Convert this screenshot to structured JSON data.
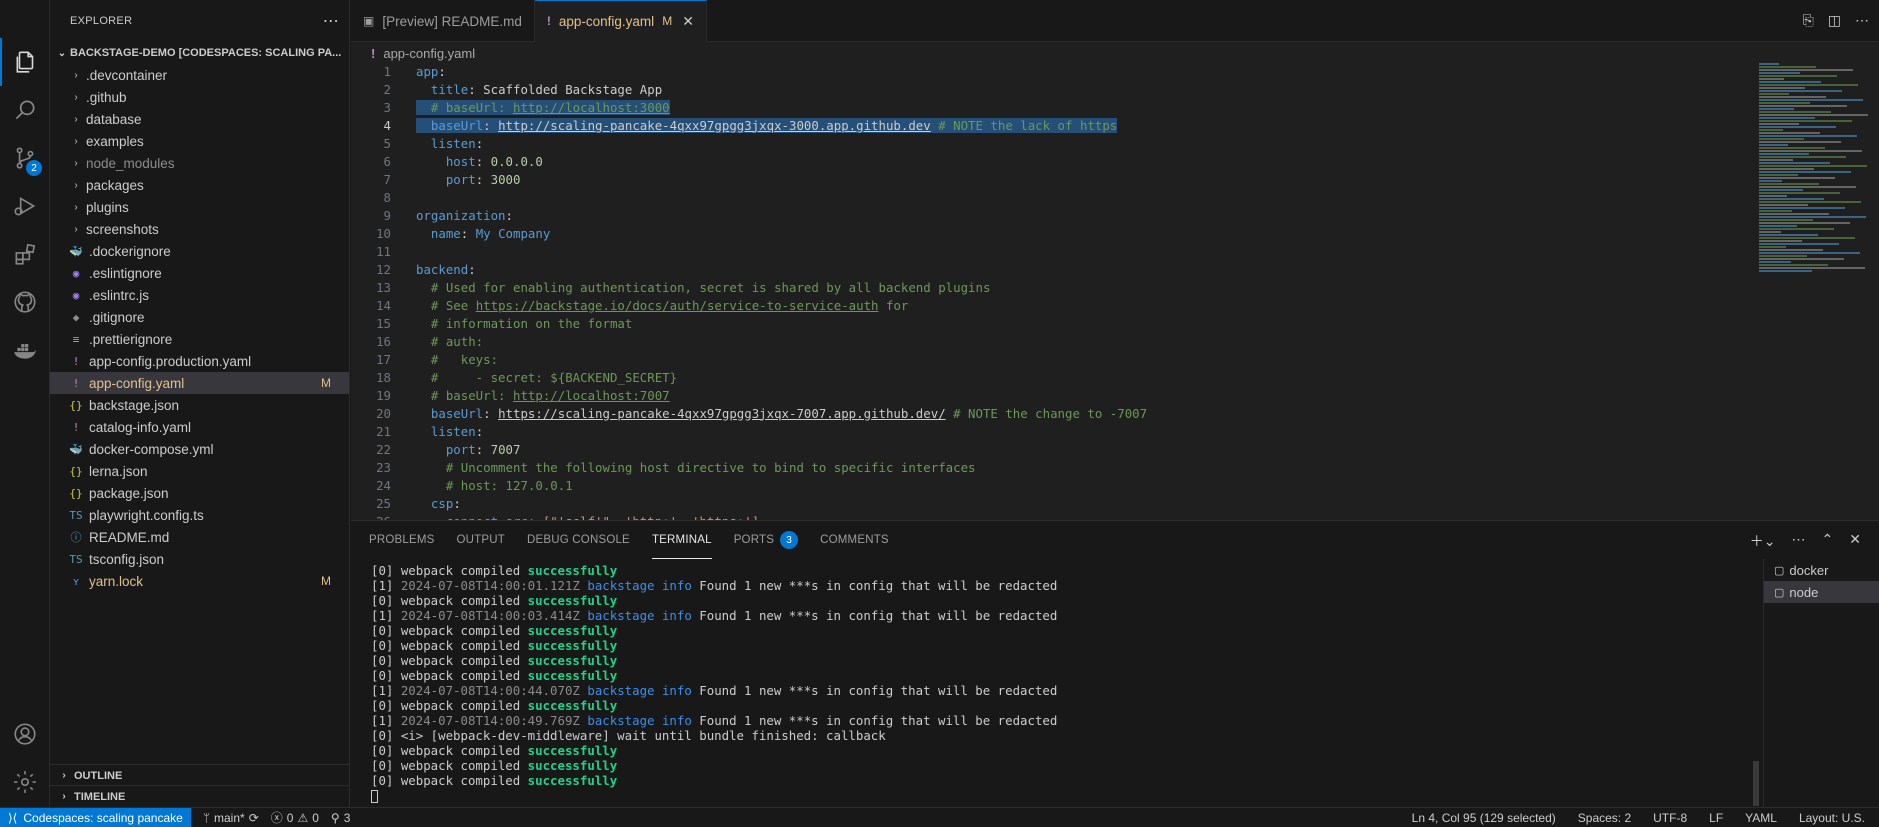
{
  "explorer": {
    "title": "EXPLORER",
    "project": "BACKSTAGE-DEMO [CODESPACES: SCALING PA...",
    "items": [
      {
        "name": ".devcontainer",
        "type": "folder"
      },
      {
        "name": ".github",
        "type": "folder"
      },
      {
        "name": "database",
        "type": "folder"
      },
      {
        "name": "examples",
        "type": "folder"
      },
      {
        "name": "node_modules",
        "type": "folder",
        "dim": true
      },
      {
        "name": "packages",
        "type": "folder"
      },
      {
        "name": "plugins",
        "type": "folder"
      },
      {
        "name": "screenshots",
        "type": "folder"
      },
      {
        "name": ".dockerignore",
        "icon": "docker-icon"
      },
      {
        "name": ".eslintignore",
        "icon": "eslint-icon"
      },
      {
        "name": ".eslintrc.js",
        "icon": "eslint-icon"
      },
      {
        "name": ".gitignore",
        "icon": "git-icon"
      },
      {
        "name": ".prettierignore",
        "icon": "lines-icon"
      },
      {
        "name": "app-config.production.yaml",
        "icon": "yaml-icon"
      },
      {
        "name": "app-config.yaml",
        "icon": "yaml-icon",
        "selected": true,
        "modified": "M"
      },
      {
        "name": "backstage.json",
        "icon": "json-icon"
      },
      {
        "name": "catalog-info.yaml",
        "icon": "yaml-icon"
      },
      {
        "name": "docker-compose.yml",
        "icon": "docker-icon"
      },
      {
        "name": "lerna.json",
        "icon": "json-icon"
      },
      {
        "name": "package.json",
        "icon": "json-icon"
      },
      {
        "name": "playwright.config.ts",
        "icon": "ts-icon"
      },
      {
        "name": "README.md",
        "icon": "info-icon"
      },
      {
        "name": "tsconfig.json",
        "icon": "ts-icon"
      },
      {
        "name": "yarn.lock",
        "icon": "yarn-icon",
        "modified": "M"
      }
    ],
    "outline": "OUTLINE",
    "timeline": "TIMELINE"
  },
  "activity": {
    "scm_badge": "2"
  },
  "tabs": [
    {
      "label": "[Preview] README.md"
    },
    {
      "label": "app-config.yaml",
      "modified": "M",
      "active": true
    }
  ],
  "breadcrumb": "app-config.yaml",
  "code_lines": [
    [
      {
        "t": "app",
        "c": "k"
      },
      {
        "t": ":"
      }
    ],
    [
      {
        "t": "  "
      },
      {
        "t": "title",
        "c": "k"
      },
      {
        "t": ": Scaffolded Backstage App"
      }
    ],
    [
      {
        "t": "  "
      },
      {
        "t": "# baseUrl: ",
        "c": "c"
      },
      {
        "t": "http://localhost:3000",
        "c": "cu"
      }
    ],
    [
      {
        "t": "  "
      },
      {
        "t": "baseUrl",
        "c": "k"
      },
      {
        "t": ": "
      },
      {
        "t": "http://scaling-pancake-4qxx97gpgg3jxqx-3000.app.github.dev",
        "c": "u"
      },
      {
        "t": " "
      },
      {
        "t": "# NOTE the lack of https",
        "c": "c"
      }
    ],
    [
      {
        "t": "  "
      },
      {
        "t": "listen",
        "c": "k"
      },
      {
        "t": ":"
      }
    ],
    [
      {
        "t": "    "
      },
      {
        "t": "host",
        "c": "k"
      },
      {
        "t": ": "
      },
      {
        "t": "0.0.0.0",
        "c": "n"
      }
    ],
    [
      {
        "t": "    "
      },
      {
        "t": "port",
        "c": "k"
      },
      {
        "t": ": "
      },
      {
        "t": "3000",
        "c": "n"
      }
    ],
    [],
    [
      {
        "t": "organization",
        "c": "k"
      },
      {
        "t": ":"
      }
    ],
    [
      {
        "t": "  "
      },
      {
        "t": "name",
        "c": "k"
      },
      {
        "t": ": "
      },
      {
        "t": "My Company",
        "c": "k"
      }
    ],
    [],
    [
      {
        "t": "backend",
        "c": "k"
      },
      {
        "t": ":"
      }
    ],
    [
      {
        "t": "  "
      },
      {
        "t": "# Used for enabling authentication, secret is shared by all backend plugins",
        "c": "c"
      }
    ],
    [
      {
        "t": "  "
      },
      {
        "t": "# See ",
        "c": "c"
      },
      {
        "t": "https://backstage.io/docs/auth/service-to-service-auth",
        "c": "cu"
      },
      {
        "t": " for",
        "c": "c"
      }
    ],
    [
      {
        "t": "  "
      },
      {
        "t": "# information on the format",
        "c": "c"
      }
    ],
    [
      {
        "t": "  "
      },
      {
        "t": "# auth:",
        "c": "c"
      }
    ],
    [
      {
        "t": "  "
      },
      {
        "t": "#   keys:",
        "c": "c"
      }
    ],
    [
      {
        "t": "  "
      },
      {
        "t": "#     - secret: ${BACKEND_SECRET}",
        "c": "c"
      }
    ],
    [
      {
        "t": "  "
      },
      {
        "t": "# baseUrl: ",
        "c": "c"
      },
      {
        "t": "http://localhost:7007",
        "c": "cu"
      }
    ],
    [
      {
        "t": "  "
      },
      {
        "t": "baseUrl",
        "c": "k"
      },
      {
        "t": ": "
      },
      {
        "t": "https://scaling-pancake-4qxx97gpgg3jxqx-7007.app.github.dev/",
        "c": "u"
      },
      {
        "t": " "
      },
      {
        "t": "# NOTE the change to -7007",
        "c": "c"
      }
    ],
    [
      {
        "t": "  "
      },
      {
        "t": "listen",
        "c": "k"
      },
      {
        "t": ":"
      }
    ],
    [
      {
        "t": "    "
      },
      {
        "t": "port",
        "c": "k"
      },
      {
        "t": ": "
      },
      {
        "t": "7007",
        "c": "n"
      }
    ],
    [
      {
        "t": "    "
      },
      {
        "t": "# Uncomment the following host directive to bind to specific interfaces",
        "c": "c"
      }
    ],
    [
      {
        "t": "    "
      },
      {
        "t": "# host: 127.0.0.1",
        "c": "c"
      }
    ],
    [
      {
        "t": "  "
      },
      {
        "t": "csp",
        "c": "k"
      },
      {
        "t": ":"
      }
    ],
    [
      {
        "t": "    "
      },
      {
        "t": "connect-src",
        "c": "k"
      },
      {
        "t": ": "
      },
      {
        "t": "[\"'self'\", 'http:', 'https:']",
        "c": "s"
      }
    ]
  ],
  "panel": {
    "tabs": [
      "PROBLEMS",
      "OUTPUT",
      "DEBUG CONSOLE",
      "TERMINAL",
      "PORTS",
      "COMMENTS"
    ],
    "active_tab": "TERMINAL",
    "ports_badge": "3",
    "terminal_lines": [
      [
        {
          "t": "[0] webpack compiled "
        },
        {
          "t": "successfully",
          "c": "g"
        }
      ],
      [
        {
          "t": "[1] "
        },
        {
          "t": "2024-07-08T14:00:01.121Z",
          "c": "ts"
        },
        {
          "t": " "
        },
        {
          "t": "backstage",
          "c": "bs"
        },
        {
          "t": " "
        },
        {
          "t": "info",
          "c": "inf"
        },
        {
          "t": " Found 1 new ***s in config that will be redacted"
        }
      ],
      [
        {
          "t": "[0] webpack compiled "
        },
        {
          "t": "successfully",
          "c": "g"
        }
      ],
      [
        {
          "t": "[1] "
        },
        {
          "t": "2024-07-08T14:00:03.414Z",
          "c": "ts"
        },
        {
          "t": " "
        },
        {
          "t": "backstage",
          "c": "bs"
        },
        {
          "t": " "
        },
        {
          "t": "info",
          "c": "inf"
        },
        {
          "t": " Found 1 new ***s in config that will be redacted"
        }
      ],
      [
        {
          "t": "[0] webpack compiled "
        },
        {
          "t": "successfully",
          "c": "g"
        }
      ],
      [
        {
          "t": "[0] webpack compiled "
        },
        {
          "t": "successfully",
          "c": "g"
        }
      ],
      [
        {
          "t": "[0] webpack compiled "
        },
        {
          "t": "successfully",
          "c": "g"
        }
      ],
      [
        {
          "t": "[0] webpack compiled "
        },
        {
          "t": "successfully",
          "c": "g"
        }
      ],
      [
        {
          "t": "[1] "
        },
        {
          "t": "2024-07-08T14:00:44.070Z",
          "c": "ts"
        },
        {
          "t": " "
        },
        {
          "t": "backstage",
          "c": "bs"
        },
        {
          "t": " "
        },
        {
          "t": "info",
          "c": "inf"
        },
        {
          "t": " Found 1 new ***s in config that will be redacted"
        }
      ],
      [
        {
          "t": "[0] webpack compiled "
        },
        {
          "t": "successfully",
          "c": "g"
        }
      ],
      [
        {
          "t": "[1] "
        },
        {
          "t": "2024-07-08T14:00:49.769Z",
          "c": "ts"
        },
        {
          "t": " "
        },
        {
          "t": "backstage",
          "c": "bs"
        },
        {
          "t": " "
        },
        {
          "t": "info",
          "c": "inf"
        },
        {
          "t": " Found 1 new ***s in config that will be redacted"
        }
      ],
      [
        {
          "t": "[0] <i> [webpack-dev-middleware] wait until bundle finished: callback"
        }
      ],
      [
        {
          "t": "[0] webpack compiled "
        },
        {
          "t": "successfully",
          "c": "g"
        }
      ],
      [
        {
          "t": "[0] webpack compiled "
        },
        {
          "t": "successfully",
          "c": "g"
        }
      ],
      [
        {
          "t": "[0] webpack compiled "
        },
        {
          "t": "successfully",
          "c": "g"
        }
      ]
    ],
    "terminals": [
      {
        "label": "docker"
      },
      {
        "label": "node",
        "selected": true
      }
    ]
  },
  "status": {
    "remote": "Codespaces: scaling pancake",
    "branch": "main*",
    "errors": "0",
    "warnings": "0",
    "ports": "3",
    "cursor": "Ln 4, Col 95 (129 selected)",
    "spaces": "Spaces: 2",
    "encoding": "UTF-8",
    "eol": "LF",
    "language": "YAML",
    "layout": "Layout: U.S."
  },
  "colors": {
    "accent": "#0078d4",
    "modified": "#e2c08d",
    "success": "#23d18b"
  }
}
